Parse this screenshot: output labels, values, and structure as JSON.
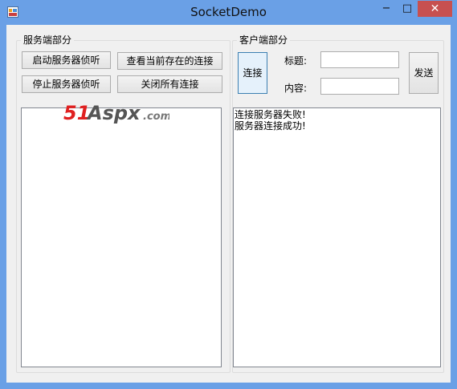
{
  "window": {
    "title": "SocketDemo",
    "controls": {
      "minimize": "−",
      "maximize": "□",
      "close": "✕"
    }
  },
  "server": {
    "group_label": "服务端部分",
    "start_button": "启动服务器侦听",
    "view_button": "查看当前存在的连接",
    "stop_button": "停止服务器侦听",
    "close_all_button": "关闭所有连接",
    "log_lines": []
  },
  "client": {
    "group_label": "客户端部分",
    "connect_button": "连接",
    "send_button": "发送",
    "title_label": "标题:",
    "content_label": "内容:",
    "title_value": "",
    "content_value": "",
    "log_lines": [
      "连接服务器失败!",
      "服务器连接成功!"
    ]
  },
  "watermark": {
    "part1": "51",
    "part2": "Aspx",
    "part3": ".com"
  },
  "icons": {
    "app": "app-window-icon"
  }
}
